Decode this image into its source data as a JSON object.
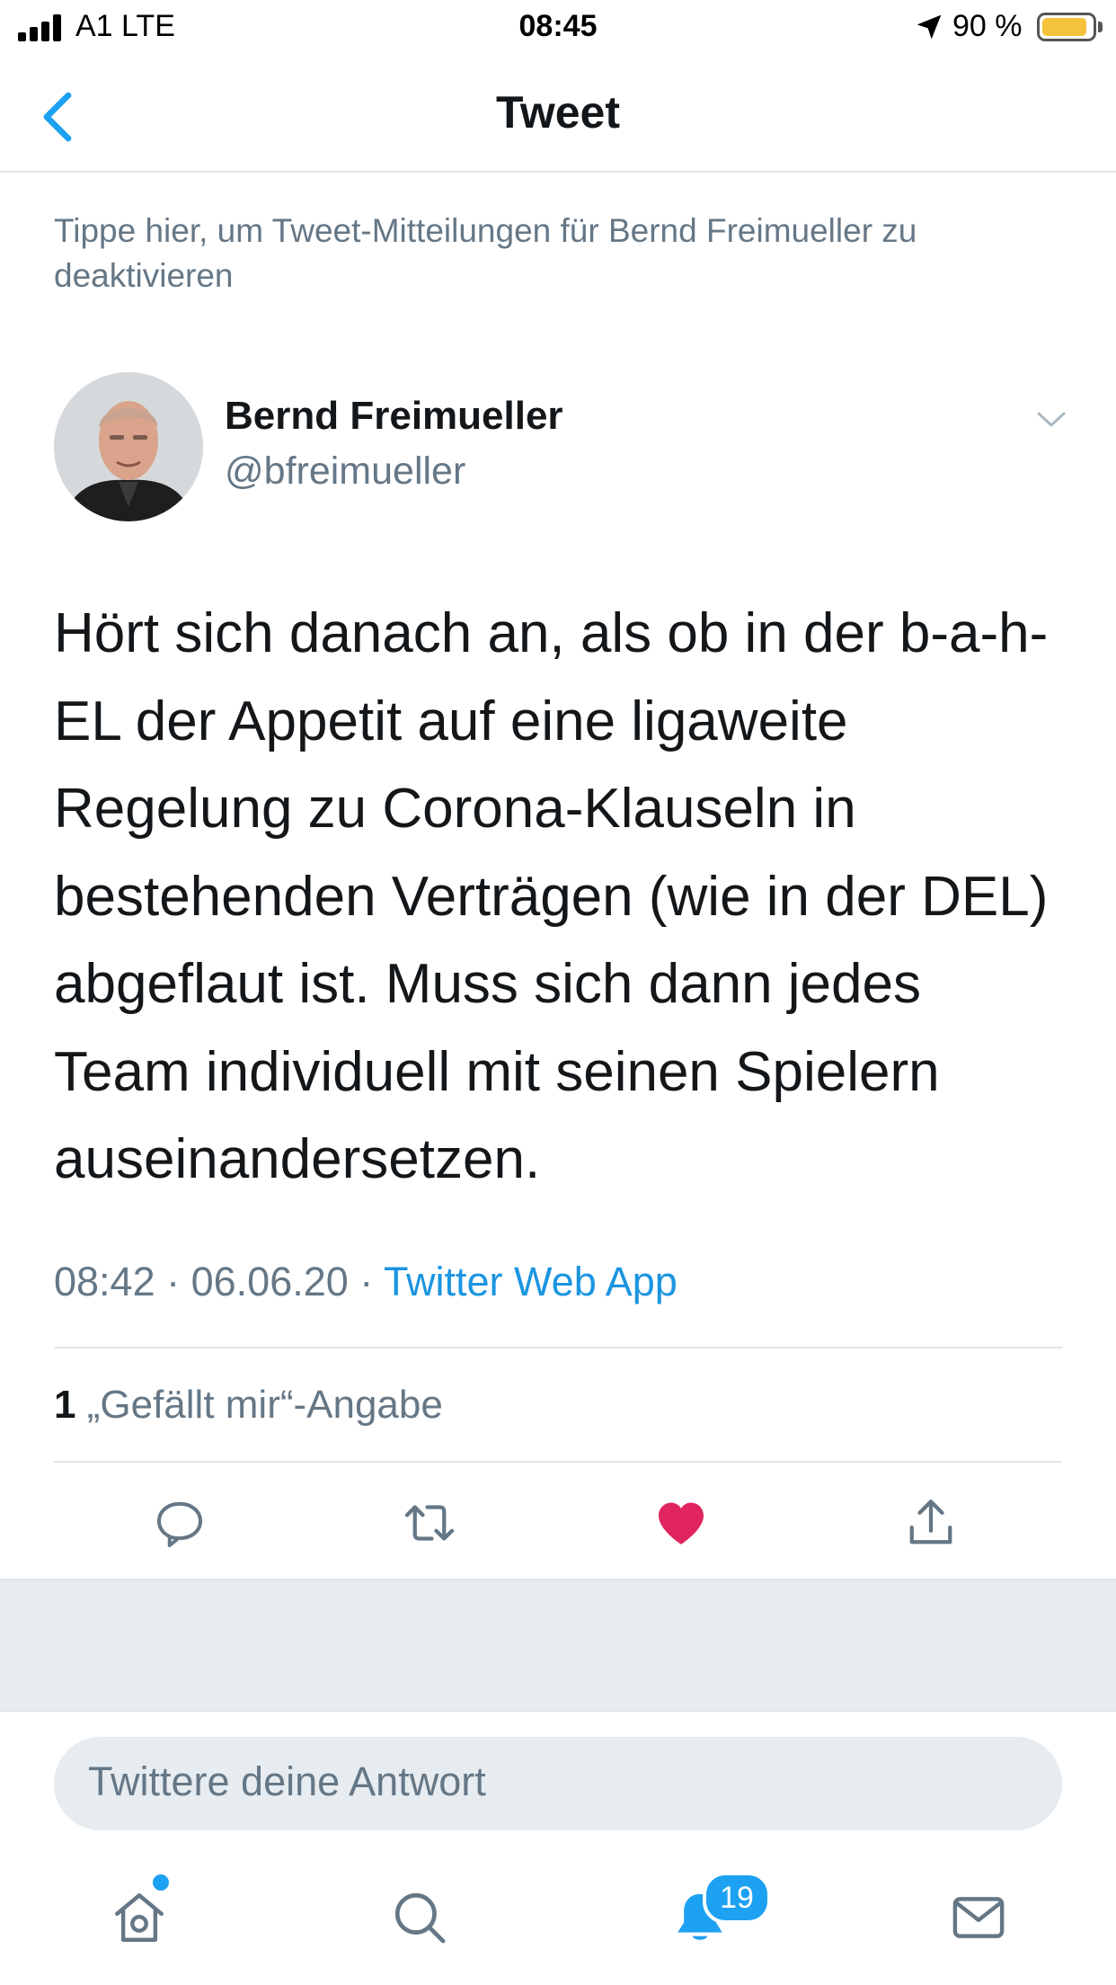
{
  "status_bar": {
    "carrier": "A1  LTE",
    "time": "08:45",
    "battery": "90 %",
    "battery_level": 0.9
  },
  "nav": {
    "title": "Tweet",
    "back_icon": "chevron-left-icon"
  },
  "notice": "Tippe hier, um Tweet-Mitteilungen für Bernd Freimueller zu deaktivieren",
  "tweet": {
    "author_name": "Bernd Freimueller",
    "handle": "@bfreimueller",
    "text": "Hört sich danach an, als ob in der b-a-h-EL der Appetit auf eine ligaweite Regelung zu Corona-Klauseln in bestehenden Verträgen (wie in der DEL) abgeflaut ist. Muss sich dann jedes Team individuell mit seinen Spielern auseinandersetzen.",
    "time": "08:42",
    "date": "06.06.20",
    "source": "Twitter Web App",
    "like_count": "1",
    "like_label": "„Gefällt mir“-Angabe",
    "liked": true
  },
  "actions": [
    "reply-icon",
    "retweet-icon",
    "heart-icon",
    "share-icon"
  ],
  "reply_box": {
    "placeholder": "Twittere deine Antwort"
  },
  "tabbar": {
    "items": [
      "home-icon",
      "search-icon",
      "notifications-icon",
      "messages-icon"
    ],
    "notifications_badge": "19"
  },
  "colors": {
    "accent": "#1da1f2",
    "like": "#e0245e",
    "secondary_text": "#657786"
  }
}
